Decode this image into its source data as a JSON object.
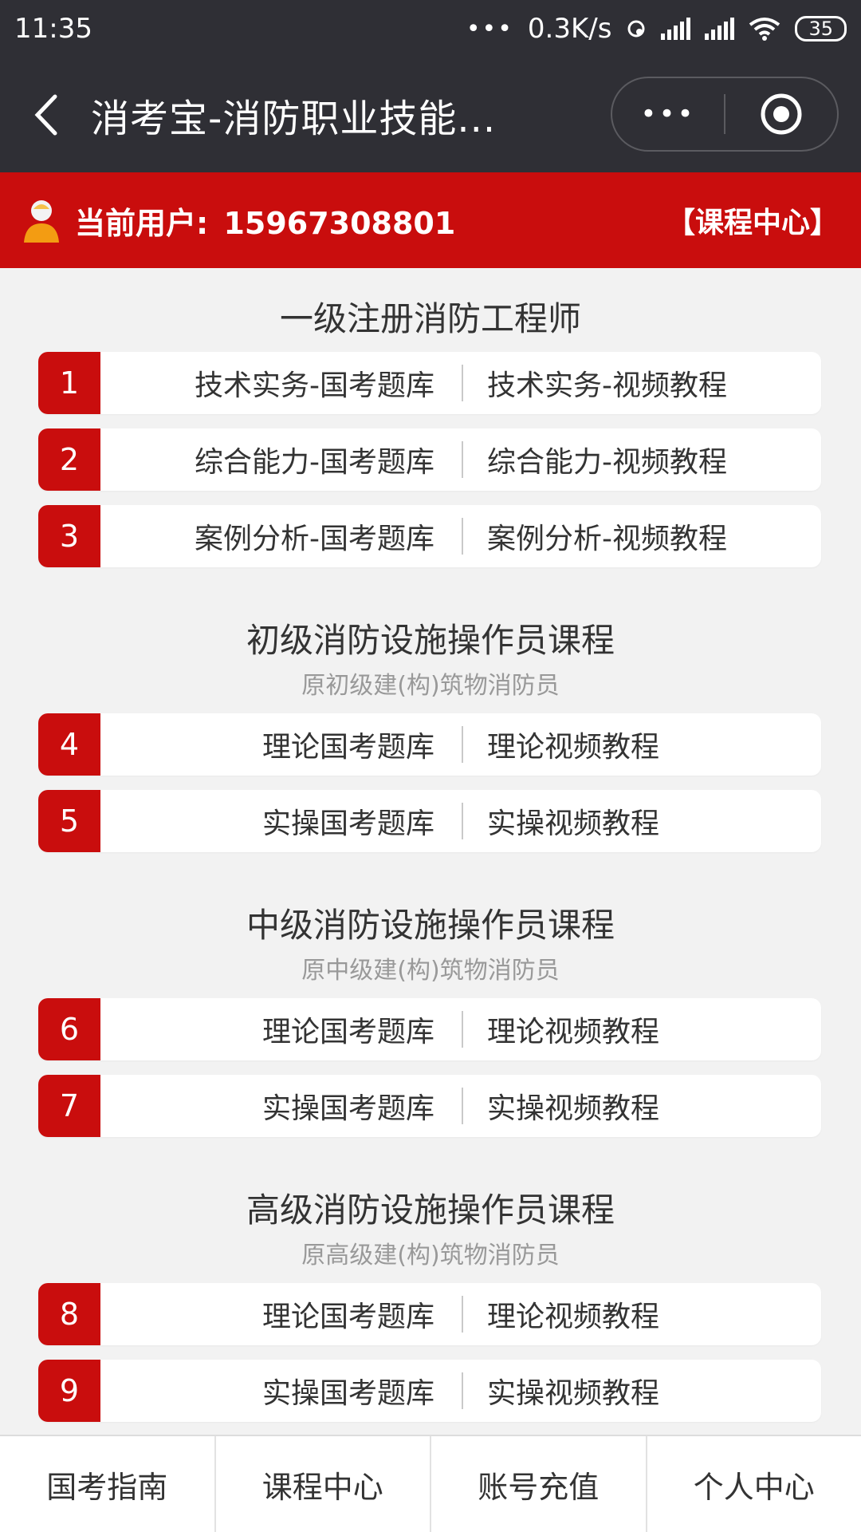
{
  "status": {
    "time": "11:35",
    "dots": "•••",
    "speed": "0.3K/s",
    "battery": "35"
  },
  "header": {
    "title": "消考宝-消防职业技能...",
    "menu": "•••"
  },
  "userbar": {
    "label": "当前用户:",
    "phone": "15967308801",
    "right": "【课程中心】"
  },
  "sections": [
    {
      "title": "一级注册消防工程师",
      "subtitle": "",
      "rows": [
        {
          "num": "1",
          "left": "技术实务-国考题库",
          "right": "技术实务-视频教程"
        },
        {
          "num": "2",
          "left": "综合能力-国考题库",
          "right": "综合能力-视频教程"
        },
        {
          "num": "3",
          "left": "案例分析-国考题库",
          "right": "案例分析-视频教程"
        }
      ]
    },
    {
      "title": "初级消防设施操作员课程",
      "subtitle": "原初级建(构)筑物消防员",
      "rows": [
        {
          "num": "4",
          "left": "理论国考题库",
          "right": "理论视频教程"
        },
        {
          "num": "5",
          "left": "实操国考题库",
          "right": "实操视频教程"
        }
      ]
    },
    {
      "title": "中级消防设施操作员课程",
      "subtitle": "原中级建(构)筑物消防员",
      "rows": [
        {
          "num": "6",
          "left": "理论国考题库",
          "right": "理论视频教程"
        },
        {
          "num": "7",
          "left": "实操国考题库",
          "right": "实操视频教程"
        }
      ]
    },
    {
      "title": "高级消防设施操作员课程",
      "subtitle": "原高级建(构)筑物消防员",
      "rows": [
        {
          "num": "8",
          "left": "理论国考题库",
          "right": "理论视频教程"
        },
        {
          "num": "9",
          "left": "实操国考题库",
          "right": "实操视频教程"
        }
      ]
    }
  ],
  "tabbar": {
    "items": [
      "国考指南",
      "课程中心",
      "账号充值",
      "个人中心"
    ]
  },
  "colors": {
    "brand_red": "#c90d0d",
    "header_dark": "#2f2f35"
  }
}
